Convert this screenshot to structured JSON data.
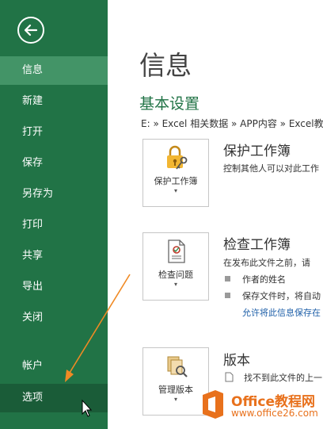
{
  "sidebar": {
    "items": [
      {
        "label": "信息"
      },
      {
        "label": "新建"
      },
      {
        "label": "打开"
      },
      {
        "label": "保存"
      },
      {
        "label": "另存为"
      },
      {
        "label": "打印"
      },
      {
        "label": "共享"
      },
      {
        "label": "导出"
      },
      {
        "label": "关闭"
      },
      {
        "label": "帐户"
      },
      {
        "label": "选项"
      }
    ]
  },
  "main": {
    "title": "信息",
    "section_title": "基本设置",
    "path": "E: » Excel 相关数据 » APP内容 » Excel教",
    "protect": {
      "button_label": "保护工作簿",
      "heading": "保护工作簿",
      "description": "控制其他人可以对此工作"
    },
    "inspect": {
      "button_label": "检查问题",
      "heading": "检查工作簿",
      "description": "在发布此文件之前，请",
      "bullets": [
        "作者的姓名",
        "保存文件时，将自动"
      ],
      "link": "允许将此信息保存在"
    },
    "versions": {
      "button_label": "管理版本",
      "heading": "版本",
      "description": "找不到此文件的上一"
    }
  },
  "watermark": {
    "brand": "Office教程网",
    "url": "www.office26.com"
  },
  "colors": {
    "sidebar": "#217346",
    "sidebar_active": "#439467",
    "accent_green": "#217346",
    "arrow": "#f08a24",
    "watermark": "#e8711c"
  }
}
